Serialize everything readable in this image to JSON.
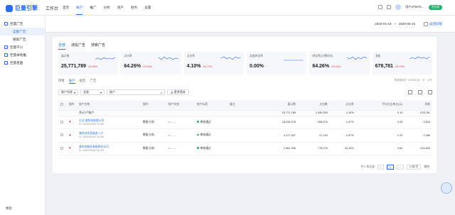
{
  "header": {
    "logo_text": "巨量引擎",
    "workspace": "工作台",
    "nav": [
      "首页",
      "账户",
      "推广",
      "分析",
      "资产",
      "财务",
      "设置"
    ],
    "user": "用户279976…",
    "badge": "专业版"
  },
  "sidebar": {
    "items": [
      {
        "label": "巨量广告",
        "active": false,
        "icon": "ad-icon"
      },
      {
        "label": "全部广告",
        "active": true,
        "sub": true
      },
      {
        "label": "搜索广告",
        "active": false,
        "sub": true
      },
      {
        "label": "巨量千川",
        "active": false,
        "icon": "qianchuan-icon"
      },
      {
        "label": "巨量本地推",
        "active": false,
        "icon": "local-icon"
      },
      {
        "label": "巨量星图",
        "active": false,
        "icon": "star-icon"
      }
    ],
    "bottom": "体验"
  },
  "subbar": {
    "date_from": "2020-04-23",
    "date_sep": "~",
    "date_to": "2020-06-15",
    "back": "返回旧版"
  },
  "tabs": [
    "全部",
    "通投广告",
    "搜索广告"
  ],
  "cards": [
    {
      "label": "展示数",
      "value": "25,771,789",
      "change": "-40.86%"
    },
    {
      "label": "点击率",
      "value": "64.26%",
      "change": "-53.06%"
    },
    {
      "label": "点击率",
      "value": "4.10%",
      "change": "-54.72%"
    },
    {
      "label": "深度转化率",
      "value": "0.00%",
      "change": ""
    },
    {
      "label": "转化率(计费时间)",
      "value": "64.26%",
      "change": "-53.06%"
    },
    {
      "label": "消耗",
      "value": "678,781",
      "change": "-39.05%"
    }
  ],
  "subtabs": [
    "项目",
    "账户",
    "组合",
    "广告"
  ],
  "sync_note": "数据更新于 2020年4月 · 分 · 小时",
  "filter": {
    "field": "账户名称",
    "scope": "全部",
    "keyword": "账户",
    "more": "更多筛选"
  },
  "table": {
    "headers": [
      "操作",
      "账户名称",
      "操作",
      "账户状态",
      "账户标签",
      "备注",
      "展示数",
      "点击数",
      "点击率",
      "平均点击单价(元)",
      "消耗"
    ],
    "summary": {
      "label": "共计3个账户",
      "impressions": "25,771,789",
      "clicks": "1,090,393",
      "ctr": "4.10%",
      "cpc": "0.10",
      "cost": "678,781"
    },
    "rows": [
      {
        "name": "企业-某科技有限公司",
        "id": "ID: 1656991650761089",
        "op": "数据  分析",
        "status": "● ——",
        "tag": "审核通过",
        "impressions": "18,516,978",
        "clicks": "286,876",
        "ctr": "1.67%",
        "cpc": "0.32",
        "cost": "3,818"
      },
      {
        "name": "某科技信息服务二户",
        "id": "ID: 1656991650761090",
        "op": "数据  分析",
        "status": "● ——",
        "tag": "审核通过",
        "impressions": "4,217,837",
        "clicks": "21,193",
        "ctr": "0.57%",
        "cpc": "2.30",
        "cost": "2,389"
      },
      {
        "name": "某科技服务有限责任公司",
        "id": "ID: 1656991650761091",
        "op": "数据  分析",
        "status": "● ——",
        "tag": "审核通过",
        "impressions": "2,862,936",
        "clicks": "778,729",
        "ctr": "25.44%",
        "cpc": "0.82",
        "cost": "615,834"
      }
    ]
  },
  "pager": {
    "total": "共 3 条记录",
    "page": "1",
    "page_size": "10条/页",
    "goto": "跳转"
  }
}
